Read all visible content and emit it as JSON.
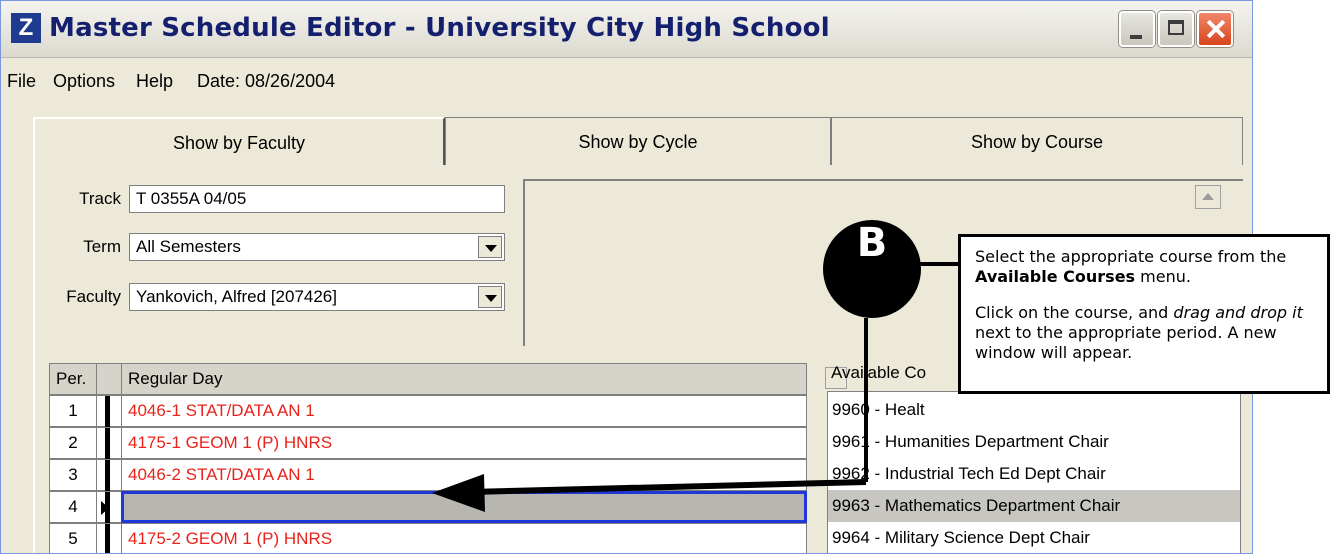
{
  "window": {
    "title": "Master Schedule Editor - University City High School",
    "app_icon": "Z"
  },
  "menu": {
    "file": "File",
    "options": "Options",
    "help": "Help",
    "date": "Date: 08/26/2004"
  },
  "tabs": [
    "Show by Faculty",
    "Show by Cycle",
    "Show by Course"
  ],
  "form": {
    "track_label": "Track",
    "track_value": "T 0355A 04/05",
    "term_label": "Term",
    "term_value": "All Semesters",
    "faculty_label": "Faculty",
    "faculty_value": "Yankovich, Alfred [207426]"
  },
  "grid": {
    "col_per": "Per.",
    "col_day": "Regular Day",
    "rows": [
      {
        "per": "1",
        "course": "4046-1  STAT/DATA AN 1"
      },
      {
        "per": "2",
        "course": "4175-1  GEOM 1 (P) HNRS"
      },
      {
        "per": "3",
        "course": "4046-2  STAT/DATA AN 1"
      },
      {
        "per": "4",
        "course": ""
      },
      {
        "per": "5",
        "course": "4175-2  GEOM 1 (P) HNRS"
      }
    ]
  },
  "available": {
    "label": "Available Co",
    "items": [
      "9960 - Healt",
      "9961 - Humanities Department Chair",
      "9962 - Industrial Tech Ed Dept Chair",
      "9963 - Mathematics Department Chair",
      "9964 - Military Science Dept Chair"
    ]
  },
  "callout": {
    "badge": "B",
    "line1_a": "Select the appropriate course from the ",
    "line1_bold": "Available Courses",
    "line1_b": " menu.",
    "line2_a": "Click on the course, and ",
    "line2_italic": "drag and drop it",
    "line2_b": " next to the appropriate period. A new window will appear."
  }
}
